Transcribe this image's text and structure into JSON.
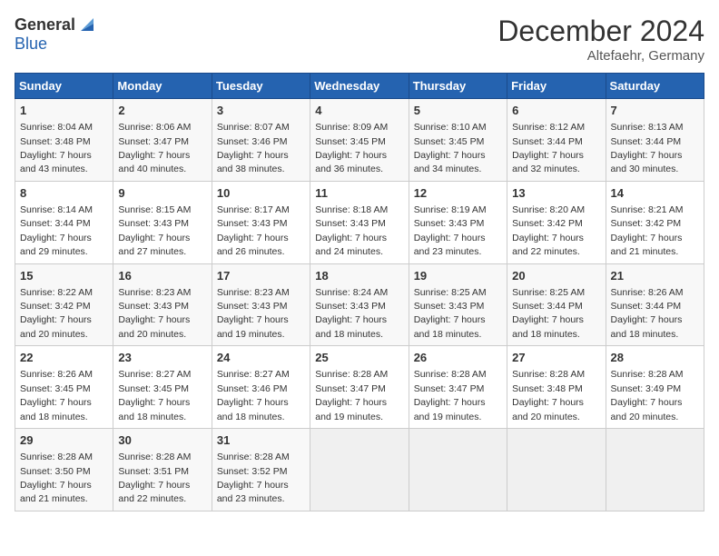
{
  "header": {
    "logo_general": "General",
    "logo_blue": "Blue",
    "month_title": "December 2024",
    "location": "Altefaehr, Germany"
  },
  "days_of_week": [
    "Sunday",
    "Monday",
    "Tuesday",
    "Wednesday",
    "Thursday",
    "Friday",
    "Saturday"
  ],
  "weeks": [
    [
      {
        "day": "1",
        "info": "Sunrise: 8:04 AM\nSunset: 3:48 PM\nDaylight: 7 hours\nand 43 minutes."
      },
      {
        "day": "2",
        "info": "Sunrise: 8:06 AM\nSunset: 3:47 PM\nDaylight: 7 hours\nand 40 minutes."
      },
      {
        "day": "3",
        "info": "Sunrise: 8:07 AM\nSunset: 3:46 PM\nDaylight: 7 hours\nand 38 minutes."
      },
      {
        "day": "4",
        "info": "Sunrise: 8:09 AM\nSunset: 3:45 PM\nDaylight: 7 hours\nand 36 minutes."
      },
      {
        "day": "5",
        "info": "Sunrise: 8:10 AM\nSunset: 3:45 PM\nDaylight: 7 hours\nand 34 minutes."
      },
      {
        "day": "6",
        "info": "Sunrise: 8:12 AM\nSunset: 3:44 PM\nDaylight: 7 hours\nand 32 minutes."
      },
      {
        "day": "7",
        "info": "Sunrise: 8:13 AM\nSunset: 3:44 PM\nDaylight: 7 hours\nand 30 minutes."
      }
    ],
    [
      {
        "day": "8",
        "info": "Sunrise: 8:14 AM\nSunset: 3:44 PM\nDaylight: 7 hours\nand 29 minutes."
      },
      {
        "day": "9",
        "info": "Sunrise: 8:15 AM\nSunset: 3:43 PM\nDaylight: 7 hours\nand 27 minutes."
      },
      {
        "day": "10",
        "info": "Sunrise: 8:17 AM\nSunset: 3:43 PM\nDaylight: 7 hours\nand 26 minutes."
      },
      {
        "day": "11",
        "info": "Sunrise: 8:18 AM\nSunset: 3:43 PM\nDaylight: 7 hours\nand 24 minutes."
      },
      {
        "day": "12",
        "info": "Sunrise: 8:19 AM\nSunset: 3:43 PM\nDaylight: 7 hours\nand 23 minutes."
      },
      {
        "day": "13",
        "info": "Sunrise: 8:20 AM\nSunset: 3:42 PM\nDaylight: 7 hours\nand 22 minutes."
      },
      {
        "day": "14",
        "info": "Sunrise: 8:21 AM\nSunset: 3:42 PM\nDaylight: 7 hours\nand 21 minutes."
      }
    ],
    [
      {
        "day": "15",
        "info": "Sunrise: 8:22 AM\nSunset: 3:42 PM\nDaylight: 7 hours\nand 20 minutes."
      },
      {
        "day": "16",
        "info": "Sunrise: 8:23 AM\nSunset: 3:43 PM\nDaylight: 7 hours\nand 20 minutes."
      },
      {
        "day": "17",
        "info": "Sunrise: 8:23 AM\nSunset: 3:43 PM\nDaylight: 7 hours\nand 19 minutes."
      },
      {
        "day": "18",
        "info": "Sunrise: 8:24 AM\nSunset: 3:43 PM\nDaylight: 7 hours\nand 18 minutes."
      },
      {
        "day": "19",
        "info": "Sunrise: 8:25 AM\nSunset: 3:43 PM\nDaylight: 7 hours\nand 18 minutes."
      },
      {
        "day": "20",
        "info": "Sunrise: 8:25 AM\nSunset: 3:44 PM\nDaylight: 7 hours\nand 18 minutes."
      },
      {
        "day": "21",
        "info": "Sunrise: 8:26 AM\nSunset: 3:44 PM\nDaylight: 7 hours\nand 18 minutes."
      }
    ],
    [
      {
        "day": "22",
        "info": "Sunrise: 8:26 AM\nSunset: 3:45 PM\nDaylight: 7 hours\nand 18 minutes."
      },
      {
        "day": "23",
        "info": "Sunrise: 8:27 AM\nSunset: 3:45 PM\nDaylight: 7 hours\nand 18 minutes."
      },
      {
        "day": "24",
        "info": "Sunrise: 8:27 AM\nSunset: 3:46 PM\nDaylight: 7 hours\nand 18 minutes."
      },
      {
        "day": "25",
        "info": "Sunrise: 8:28 AM\nSunset: 3:47 PM\nDaylight: 7 hours\nand 19 minutes."
      },
      {
        "day": "26",
        "info": "Sunrise: 8:28 AM\nSunset: 3:47 PM\nDaylight: 7 hours\nand 19 minutes."
      },
      {
        "day": "27",
        "info": "Sunrise: 8:28 AM\nSunset: 3:48 PM\nDaylight: 7 hours\nand 20 minutes."
      },
      {
        "day": "28",
        "info": "Sunrise: 8:28 AM\nSunset: 3:49 PM\nDaylight: 7 hours\nand 20 minutes."
      }
    ],
    [
      {
        "day": "29",
        "info": "Sunrise: 8:28 AM\nSunset: 3:50 PM\nDaylight: 7 hours\nand 21 minutes."
      },
      {
        "day": "30",
        "info": "Sunrise: 8:28 AM\nSunset: 3:51 PM\nDaylight: 7 hours\nand 22 minutes."
      },
      {
        "day": "31",
        "info": "Sunrise: 8:28 AM\nSunset: 3:52 PM\nDaylight: 7 hours\nand 23 minutes."
      },
      {
        "day": "",
        "info": ""
      },
      {
        "day": "",
        "info": ""
      },
      {
        "day": "",
        "info": ""
      },
      {
        "day": "",
        "info": ""
      }
    ]
  ]
}
